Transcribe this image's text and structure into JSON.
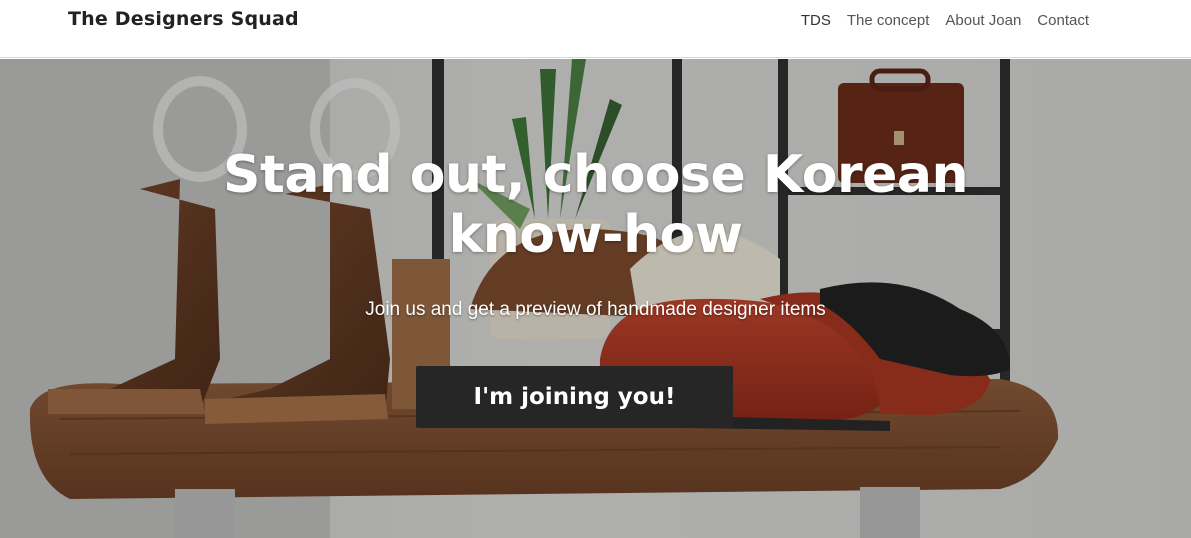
{
  "header": {
    "brand": "The Designers Squad",
    "nav": [
      {
        "label": "TDS"
      },
      {
        "label": "The concept"
      },
      {
        "label": "About Joan"
      },
      {
        "label": "Contact"
      }
    ]
  },
  "hero": {
    "title_line1": "Stand out, choose Korean",
    "title_line2": "know-how",
    "subtitle": "Join us and get a preview of handmade designer items",
    "cta_label": "I'm joining you!"
  },
  "colors": {
    "button": "#262626",
    "header_bg": "#ffffff",
    "brand_text": "#222222",
    "nav_text": "#555555"
  }
}
